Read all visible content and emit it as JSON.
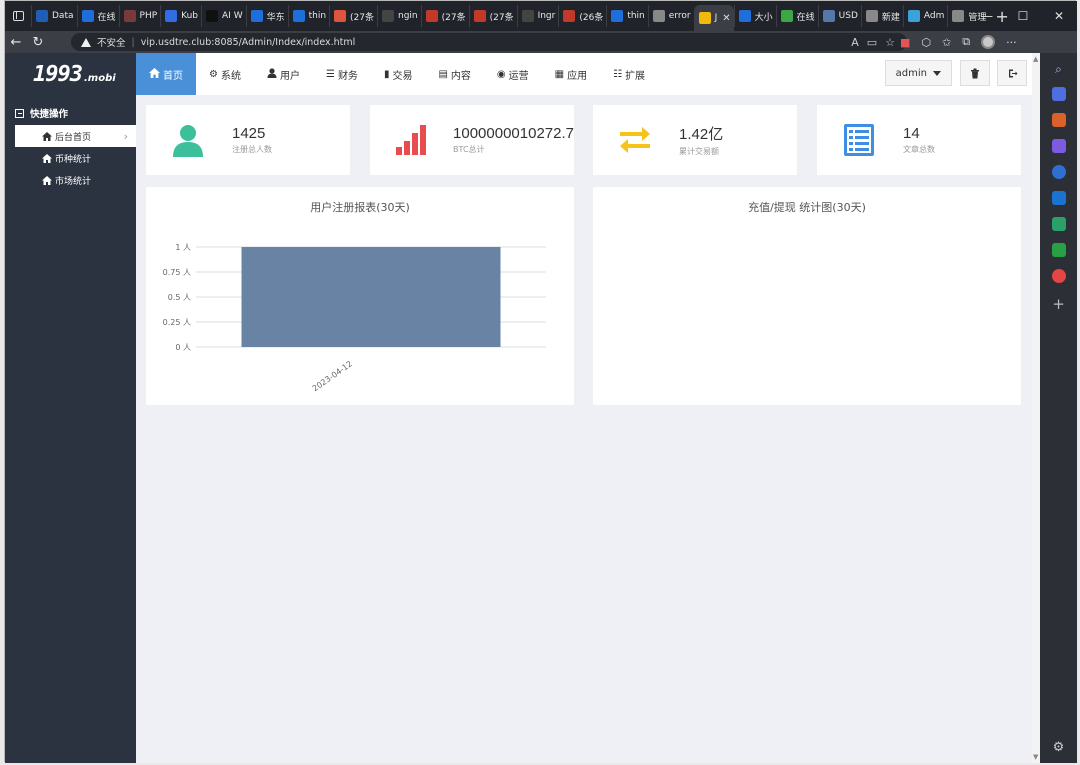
{
  "browser": {
    "tabs": [
      {
        "label": "Data",
        "color": "#1e5eb5"
      },
      {
        "label": "在线",
        "color": "#1e6fd9"
      },
      {
        "label": "PHP",
        "color": "#7b3a3a"
      },
      {
        "label": "Kub",
        "color": "#326ce5"
      },
      {
        "label": "AI W",
        "color": "#111111"
      },
      {
        "label": "华东",
        "color": "#1e6fd9"
      },
      {
        "label": "thin",
        "color": "#1e6fd9"
      },
      {
        "label": "(27条",
        "color": "#e0533c"
      },
      {
        "label": "ngin",
        "color": "#444444"
      },
      {
        "label": "(27条",
        "color": "#c0392b"
      },
      {
        "label": "(27条",
        "color": "#c0392b"
      },
      {
        "label": "Ingr",
        "color": "#444444"
      },
      {
        "label": "(26条",
        "color": "#c0392b"
      },
      {
        "label": "thin",
        "color": "#1e6fd9"
      },
      {
        "label": "error",
        "color": "#888888"
      },
      {
        "label": "J",
        "color": "#f0b90b",
        "active": true
      },
      {
        "label": "大小",
        "color": "#1e6fd9"
      },
      {
        "label": "在线",
        "color": "#39a845"
      },
      {
        "label": "USD",
        "color": "#5577aa"
      },
      {
        "label": "新建",
        "color": "#888888"
      },
      {
        "label": "Adm",
        "color": "#3aa3d9"
      },
      {
        "label": "管理",
        "color": "#888888"
      }
    ],
    "security_label": "不安全",
    "url": "vip.usdtre.club:8085/Admin/Index/index.html"
  },
  "sidebar": {
    "logo_big": "1993",
    "logo_small": ".mobi",
    "section_title": "快捷操作",
    "items": [
      {
        "label": "后台首页",
        "active": true
      },
      {
        "label": "币种统计"
      },
      {
        "label": "市场统计"
      }
    ]
  },
  "topnav": {
    "items": [
      {
        "label": "首页",
        "icon": "home-icon",
        "active": true
      },
      {
        "label": "系统",
        "icon": "gear-icon"
      },
      {
        "label": "用户",
        "icon": "user-icon"
      },
      {
        "label": "财务",
        "icon": "list-icon"
      },
      {
        "label": "交易",
        "icon": "bar-chart-icon"
      },
      {
        "label": "内容",
        "icon": "document-icon"
      },
      {
        "label": "运营",
        "icon": "globe-icon"
      },
      {
        "label": "应用",
        "icon": "grid-icon"
      },
      {
        "label": "扩展",
        "icon": "drawer-icon"
      }
    ],
    "user_label": "admin"
  },
  "stats": [
    {
      "value": "1425",
      "label": "注册总人数",
      "icon": "user-icon",
      "color": "#3dbf9b"
    },
    {
      "value": "1000000010272.7",
      "label": "BTC总计",
      "icon": "signal-bars-icon",
      "color": "#e84c4f"
    },
    {
      "value": "1.42亿",
      "label": "累计交易额",
      "icon": "exchange-arrows-icon",
      "color": "#f6c31c"
    },
    {
      "value": "14",
      "label": "文章总数",
      "icon": "article-list-icon",
      "color": "#3e8fe3"
    }
  ],
  "panels": {
    "register_title": "用户注册报表(30天)",
    "recharge_title": "充值/提现 统计图(30天)"
  },
  "chart_data": {
    "type": "bar",
    "title": "用户注册报表(30天)",
    "categories": [
      "2023-04-12"
    ],
    "values": [
      1
    ],
    "ylim": [
      0,
      1
    ],
    "yticks": [
      "0 人",
      "0.25 人",
      "0.5 人",
      "0.75 人",
      "1 人"
    ],
    "bar_color": "#6883a4",
    "grid": true
  }
}
